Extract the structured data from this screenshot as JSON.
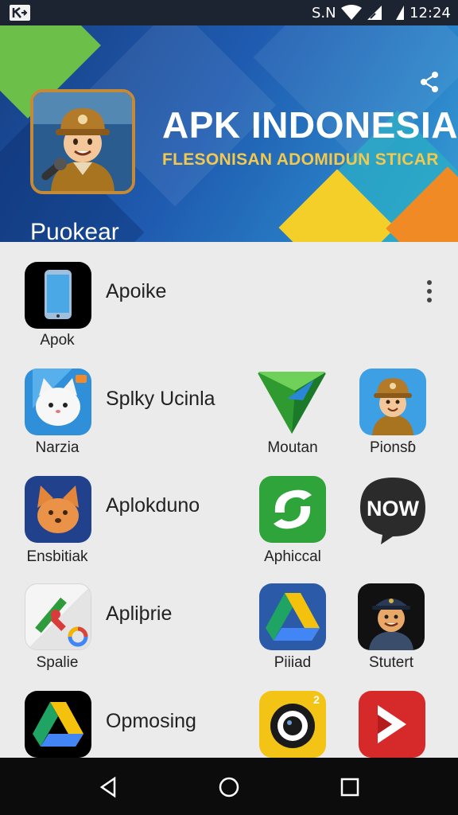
{
  "status_bar": {
    "carrier": "S.N",
    "time": "12:24",
    "icons": [
      "app-notification-icon",
      "wifi-icon",
      "signal-icon",
      "battery-signal-icon"
    ]
  },
  "header": {
    "title": "APK INDONESIA",
    "subtitle": "FLESONISAN ADOMIDUN STICAR",
    "name": "Puokear",
    "share_icon": "share-icon",
    "colors": {
      "background": "#1f5bb0",
      "subtitle": "#f2c94c",
      "yellow": "#f4cf2a",
      "orange": "#f08a24",
      "green": "#6cc04a"
    }
  },
  "rows": [
    {
      "title": "Apoike",
      "icon_label": "Apok",
      "icon": "phone-app-icon",
      "menu_icon": "more-vert-icon"
    },
    {
      "title": "Splky Ucinla",
      "icon_label": "Narzia",
      "icon": "cat-app-icon"
    },
    {
      "title": "Aplokduno",
      "icon_label": "Ensbitiak",
      "icon": "fox-app-icon"
    },
    {
      "title": "Apliþrie",
      "icon_label": "Spalie",
      "icon": "maps-app-icon"
    },
    {
      "title": "Opmosing",
      "icon_label": "",
      "icon": "drive-app-icon"
    }
  ],
  "grid_apps": [
    {
      "label": "Moutan",
      "icon": "arrow-triangle-icon"
    },
    {
      "label": "Pionsɓ",
      "icon": "character-app-icon"
    },
    {
      "label": "Aphiccal",
      "icon": "green-swirl-icon"
    },
    {
      "label": "NOW",
      "icon": "now-bubble-icon"
    },
    {
      "label": "Piiiad",
      "icon": "drive-triangle-icon"
    },
    {
      "label": "Stutert",
      "icon": "cop-character-icon"
    },
    {
      "label": "",
      "icon": "camera-lens-icon",
      "badge": "2"
    },
    {
      "label": "",
      "icon": "play-arrow-icon"
    }
  ],
  "nav": {
    "back": "back-icon",
    "home": "home-icon",
    "recents": "recents-icon"
  }
}
